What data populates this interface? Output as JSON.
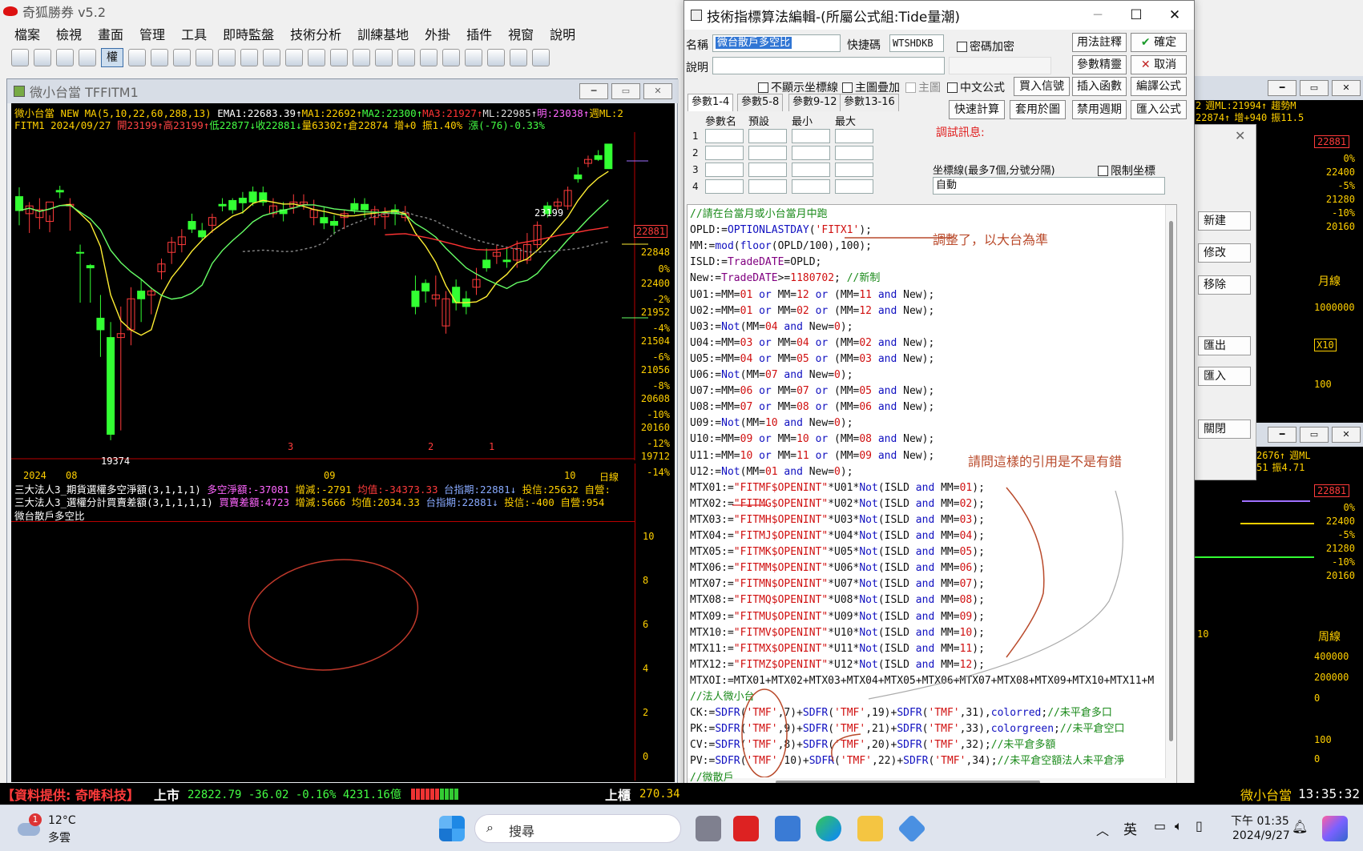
{
  "app": {
    "title": "奇狐勝券 v5.2",
    "menu": [
      "檔案",
      "檢視",
      "畫面",
      "管理",
      "工具",
      "即時監盤",
      "技術分析",
      "訓練基地",
      "外掛",
      "插件",
      "視窗",
      "說明"
    ],
    "toolbar_select": "權"
  },
  "chart": {
    "window_title": "微小台當 TFFITM1",
    "info1": {
      "symbol": "微小台當",
      "ma_label": "NEW MA(5,10,22,60,288,13)",
      "ema1": "EMA1:22683.39↑",
      "ma1": "MA1:22692↑",
      "ma2": "MA2:22300↑",
      "ma3": "MA3:21927↑",
      "ml": "ML:22985↑",
      "ming": "明:23038↑",
      "weekly": "週ML:2"
    },
    "info2": {
      "prefix": "FITM1 2024/09/27",
      "open": "開23199↑",
      "high": "高23199↑",
      "low": "低22877↓",
      "close": "收22881↓",
      "vol": "量63302↑",
      "oi": "倉22874",
      "chg": "增+0",
      "amp": "振1.40%",
      "up": "漲(-76)-0.33%"
    },
    "price_label": "22881",
    "high_label": "23199",
    "low_label": "19374",
    "y_labels": [
      "22848",
      "0%",
      "22400",
      "-2%",
      "21952",
      "-4%",
      "21504",
      "-6%",
      "21056",
      "-8%",
      "20608",
      "-10%",
      "20160",
      "-12%",
      "19712",
      "-14%"
    ],
    "x_labels": [
      "2024",
      "08",
      "3",
      "09",
      "2",
      "1",
      "10",
      "日線"
    ],
    "sub1": {
      "name": "三大法人3_期貨選權多空淨額(3,1,1,1)",
      "net": "多空淨額:-37081",
      "chg": "增減:-2791",
      "avg": "均值:-34373.33",
      "idx": "台指期:22881↓",
      "trust": "投信:25632",
      "dealer": "自營:"
    },
    "sub2": {
      "name": "三大法人3_選權分計買賣差額(3,1,1,1,1)",
      "diff": "買賣差額:4723",
      "chg": "增減:5666",
      "avg": "均值:2034.33",
      "idx": "台指期:22881↓",
      "trust": "投信:-400",
      "dealer": "自營:954"
    },
    "sub3_name": "微台散戶多空比",
    "sub3_ticks": [
      "10",
      "8",
      "6",
      "4",
      "2",
      "0"
    ],
    "candles": [
      {
        "o": 22520,
        "h": 22640,
        "l": 22150,
        "c": 22340,
        "col": "g"
      },
      {
        "o": 22300,
        "h": 22450,
        "l": 22050,
        "c": 22400,
        "col": "r"
      },
      {
        "o": 22350,
        "h": 22500,
        "l": 22100,
        "c": 22250,
        "col": "r"
      },
      {
        "o": 22200,
        "h": 22280,
        "l": 22060,
        "c": 22450,
        "col": "r"
      },
      {
        "o": 22600,
        "h": 22660,
        "l": 22500,
        "c": 22580,
        "col": "g"
      },
      {
        "o": 22400,
        "h": 22500,
        "l": 22080,
        "c": 22420,
        "col": "r"
      },
      {
        "o": 21800,
        "h": 21900,
        "l": 21150,
        "c": 21800,
        "col": "g"
      },
      {
        "o": 21600,
        "h": 21650,
        "l": 21150,
        "c": 21630,
        "col": "g"
      },
      {
        "o": 20800,
        "h": 21250,
        "l": 20450,
        "c": 20950,
        "col": "g"
      },
      {
        "o": 20700,
        "h": 20900,
        "l": 19374,
        "c": 19450,
        "col": "g"
      },
      {
        "o": 20700,
        "h": 21100,
        "l": 19500,
        "c": 20750,
        "col": "r"
      },
      {
        "o": 20800,
        "h": 21350,
        "l": 20600,
        "c": 21200,
        "col": "r"
      },
      {
        "o": 21200,
        "h": 21450,
        "l": 20900,
        "c": 21300,
        "col": "g"
      },
      {
        "o": 21250,
        "h": 21350,
        "l": 21000,
        "c": 21300,
        "col": "r"
      },
      {
        "o": 21550,
        "h": 21720,
        "l": 21450,
        "c": 21650,
        "col": "r"
      },
      {
        "o": 21800,
        "h": 22000,
        "l": 21650,
        "c": 21930,
        "col": "r"
      },
      {
        "o": 21900,
        "h": 22100,
        "l": 21800,
        "c": 22000,
        "col": "r"
      },
      {
        "o": 22100,
        "h": 22300,
        "l": 22050,
        "c": 22200,
        "col": "g"
      },
      {
        "o": 22080,
        "h": 22180,
        "l": 21950,
        "c": 22000,
        "col": "g"
      },
      {
        "o": 22150,
        "h": 22300,
        "l": 22050,
        "c": 22250,
        "col": "r"
      },
      {
        "o": 22400,
        "h": 22500,
        "l": 22330,
        "c": 22420,
        "col": "g"
      },
      {
        "o": 22350,
        "h": 22500,
        "l": 22300,
        "c": 22470,
        "col": "g"
      },
      {
        "o": 22500,
        "h": 22580,
        "l": 22300,
        "c": 22440,
        "col": "g"
      },
      {
        "o": 22450,
        "h": 22650,
        "l": 22400,
        "c": 22580,
        "col": "g"
      },
      {
        "o": 22570,
        "h": 22650,
        "l": 22400,
        "c": 22450,
        "col": "g"
      },
      {
        "o": 22400,
        "h": 22500,
        "l": 22250,
        "c": 22300,
        "col": "r"
      },
      {
        "o": 22300,
        "h": 22450,
        "l": 22200,
        "c": 22350,
        "col": "g"
      },
      {
        "o": 22380,
        "h": 22550,
        "l": 22300,
        "c": 22450,
        "col": "r"
      },
      {
        "o": 22450,
        "h": 22550,
        "l": 22350,
        "c": 22420,
        "col": "r"
      },
      {
        "o": 22350,
        "h": 22480,
        "l": 22150,
        "c": 22250,
        "col": "r"
      },
      {
        "o": 22250,
        "h": 22380,
        "l": 22100,
        "c": 22180,
        "col": "g"
      },
      {
        "o": 22150,
        "h": 22280,
        "l": 22030,
        "c": 22200,
        "col": "g"
      },
      {
        "o": 22250,
        "h": 22350,
        "l": 22100,
        "c": 22300,
        "col": "r"
      },
      {
        "o": 22350,
        "h": 22500,
        "l": 22300,
        "c": 22430,
        "col": "g"
      },
      {
        "o": 22420,
        "h": 22500,
        "l": 22250,
        "c": 22350,
        "col": "g"
      },
      {
        "o": 22350,
        "h": 22400,
        "l": 22150,
        "c": 22250,
        "col": "r"
      },
      {
        "o": 22260,
        "h": 22380,
        "l": 22100,
        "c": 22300,
        "col": "r"
      },
      {
        "o": 22300,
        "h": 22420,
        "l": 22150,
        "c": 22350,
        "col": "g"
      },
      {
        "o": 22300,
        "h": 22400,
        "l": 22200,
        "c": 22250,
        "col": "r"
      },
      {
        "o": 21300,
        "h": 21500,
        "l": 21000,
        "c": 21100,
        "col": "g"
      },
      {
        "o": 21300,
        "h": 21450,
        "l": 21150,
        "c": 21400,
        "col": "g"
      },
      {
        "o": 21200,
        "h": 21500,
        "l": 21100,
        "c": 21250,
        "col": "r"
      },
      {
        "o": 21200,
        "h": 21300,
        "l": 20750,
        "c": 20850,
        "col": "r"
      },
      {
        "o": 21350,
        "h": 21450,
        "l": 21050,
        "c": 21150,
        "col": "g"
      },
      {
        "o": 21200,
        "h": 21300,
        "l": 21000,
        "c": 21100,
        "col": "g"
      },
      {
        "o": 21350,
        "h": 21600,
        "l": 21250,
        "c": 21450,
        "col": "r"
      },
      {
        "o": 21700,
        "h": 21850,
        "l": 21550,
        "c": 21600,
        "col": "g"
      },
      {
        "o": 21800,
        "h": 21900,
        "l": 21650,
        "c": 21750,
        "col": "r"
      },
      {
        "o": 21700,
        "h": 21850,
        "l": 21600,
        "c": 21680,
        "col": "g"
      },
      {
        "o": 21700,
        "h": 21950,
        "l": 21600,
        "c": 21850,
        "col": "r"
      },
      {
        "o": 21900,
        "h": 22050,
        "l": 21650,
        "c": 21700,
        "col": "r"
      },
      {
        "o": 21900,
        "h": 22200,
        "l": 21850,
        "c": 22150,
        "col": "r"
      },
      {
        "o": 22300,
        "h": 22450,
        "l": 22250,
        "c": 22400,
        "col": "g"
      },
      {
        "o": 22400,
        "h": 22500,
        "l": 22350,
        "c": 22450,
        "col": "r"
      },
      {
        "o": 22400,
        "h": 22650,
        "l": 22350,
        "c": 22600,
        "col": "r"
      },
      {
        "o": 22800,
        "h": 22900,
        "l": 22700,
        "c": 22750,
        "col": "g"
      },
      {
        "o": 22950,
        "h": 23050,
        "l": 22900,
        "c": 23000,
        "col": "r"
      },
      {
        "o": 23050,
        "h": 23120,
        "l": 22980,
        "c": 23000,
        "col": "g"
      },
      {
        "o": 23199,
        "h": 23199,
        "l": 22877,
        "c": 22881,
        "col": "g"
      }
    ]
  },
  "dialog": {
    "title": "技術指標算法編輯-(所屬公式組:Tide量潮)",
    "name_label": "名稱",
    "name_value": "微台散戶多空比",
    "shortcut_label": "快捷碼",
    "shortcut_value": "WTSHDKB",
    "password_label": "密碼加密",
    "desc_label": "說明",
    "buttons": {
      "usage": "用法註釋",
      "ok": "確定",
      "param_tune": "參數精靈",
      "cancel": "取消",
      "insert_fn": "插入函數",
      "compile": "編譯公式",
      "quick_calc": "快速計算",
      "apply_to": "套用於圖",
      "disable_period": "禁用週期",
      "import": "匯入公式",
      "buy_sell": "買入信號"
    },
    "checks": {
      "hide_axis": "不顯示坐標線",
      "overlay": "主圖疊加",
      "main": "主圖",
      "chinese": "中文公式",
      "limit": "限制坐標"
    },
    "tabs": [
      "參數1-4",
      "參數5-8",
      "參數9-12",
      "參數13-16"
    ],
    "param_cols": [
      "參數名",
      "預設",
      "最小",
      "最大"
    ],
    "param_rows": [
      "1",
      "2",
      "3",
      "4"
    ],
    "debug_label": "調試訊息:",
    "axis_label": "坐標線(最多7個,分號分隔)",
    "axis_value": "自動"
  },
  "code_lines": [
    "//請在台當月或小台當月中跑",
    "OPLD:=OPTIONLASTDAY('FITX1');",
    "MM:=mod(floor(OPLD/100),100);",
    "ISLD:=TradeDATE=OPLD;",
    "New:=TradeDATE>=1180702; //新制",
    "U01:=MM=01 or MM=12 or (MM=11 and New);",
    "U02:=MM=01 or MM=02 or (MM=12 and New);",
    "U03:=Not(MM=04 and New=0);",
    "U04:=MM=03 or MM=04 or (MM=02 and New);",
    "U05:=MM=04 or MM=05 or (MM=03 and New);",
    "U06:=Not(MM=07 and New=0);",
    "U07:=MM=06 or MM=07 or (MM=05 and New);",
    "U08:=MM=07 or MM=08 or (MM=06 and New);",
    "U09:=Not(MM=10 and New=0);",
    "U10:=MM=09 or MM=10 or (MM=08 and New);",
    "U11:=MM=10 or MM=11 or (MM=09 and New);",
    "U12:=Not(MM=01 and New=0);",
    "MTX01:=\"FITMF$OPENINT\"*U01*Not(ISLD and MM=01);",
    "MTX02:=\"FITMG$OPENINT\"*U02*Not(ISLD and MM=02);",
    "MTX03:=\"FITMH$OPENINT\"*U03*Not(ISLD and MM=03);",
    "MTX04:=\"FITMJ$OPENINT\"*U04*Not(ISLD and MM=04);",
    "MTX05:=\"FITMK$OPENINT\"*U05*Not(ISLD and MM=05);",
    "MTX06:=\"FITMM$OPENINT\"*U06*Not(ISLD and MM=06);",
    "MTX07:=\"FITMN$OPENINT\"*U07*Not(ISLD and MM=07);",
    "MTX08:=\"FITMQ$OPENINT\"*U08*Not(ISLD and MM=08);",
    "MTX09:=\"FITMU$OPENINT\"*U09*Not(ISLD and MM=09);",
    "MTX10:=\"FITMV$OPENINT\"*U10*Not(ISLD and MM=10);",
    "MTX11:=\"FITMX$OPENINT\"*U11*Not(ISLD and MM=11);",
    "MTX12:=\"FITMZ$OPENINT\"*U12*Not(ISLD and MM=12);",
    "MTXOI:=MTX01+MTX02+MTX03+MTX04+MTX05+MTX06+MTX07+MTX08+MTX09+MTX10+MTX11+M",
    "//法人微小台",
    "CK:=SDFR('TMF',7)+SDFR('TMF',19)+SDFR('TMF',31),colorred;//未平倉多口",
    "PK:=SDFR('TMF',9)+SDFR('TMF',21)+SDFR('TMF',33),colorgreen;//未平倉空口",
    "CV:=SDFR('TMF',8)+SDFR('TMF',20)+SDFR('TMF',32);//未平倉多額",
    "PV:=SDFR('TMF',10)+SDFR('TMF',22)+SDFR('TMF',34);//未平倉空額法人未平倉淨",
    "//微散戶"
  ],
  "annotations": {
    "note1": "調整了，以大台為準",
    "note2": "請問這樣的引用是不是有錯"
  },
  "right_panel": {
    "buttons": [
      "新建",
      "修改",
      "移除",
      "匯出",
      "匯入",
      "關閉"
    ],
    "labels_top": [
      "2",
      "週ML:21994↑",
      "趨勢M",
      "22874↑",
      "增+940",
      "振11.5"
    ],
    "price": "22881",
    "y1": [
      "0%",
      "22400",
      "-5%",
      "21280",
      "-10%",
      "20160"
    ],
    "monthly": "月線",
    "vol": "1000000",
    "x10": "X10",
    "hundred": "100",
    "labels_mid": [
      "2676↑",
      "週ML",
      "51",
      "振4.71"
    ],
    "y2": [
      "0%",
      "22400",
      "-5%",
      "21280",
      "-10%",
      "20160"
    ],
    "weekly": "周線",
    "axis10": "10",
    "v2": [
      "400000",
      "200000",
      "0",
      "100",
      "0"
    ]
  },
  "status": {
    "provider": "【資料提供: 奇唯科技】",
    "market": "上市",
    "value": "22822.79 -36.02 -0.16% 4231.16億",
    "otc": "上櫃",
    "otc_value": "270.34",
    "bottom_symbol": "微小台當",
    "time": "13:35:32"
  },
  "taskbar": {
    "weather_temp": "12°C",
    "weather_desc": "多雲",
    "weather_badge": "1",
    "search": "搜尋",
    "ime": "英",
    "clock_time": "下午 01:35",
    "clock_date": "2024/9/27"
  },
  "colors": {
    "up": "#ff3b3b",
    "down": "#33ff33",
    "yellow": "#ffd000",
    "annot": "#b94a2b"
  }
}
